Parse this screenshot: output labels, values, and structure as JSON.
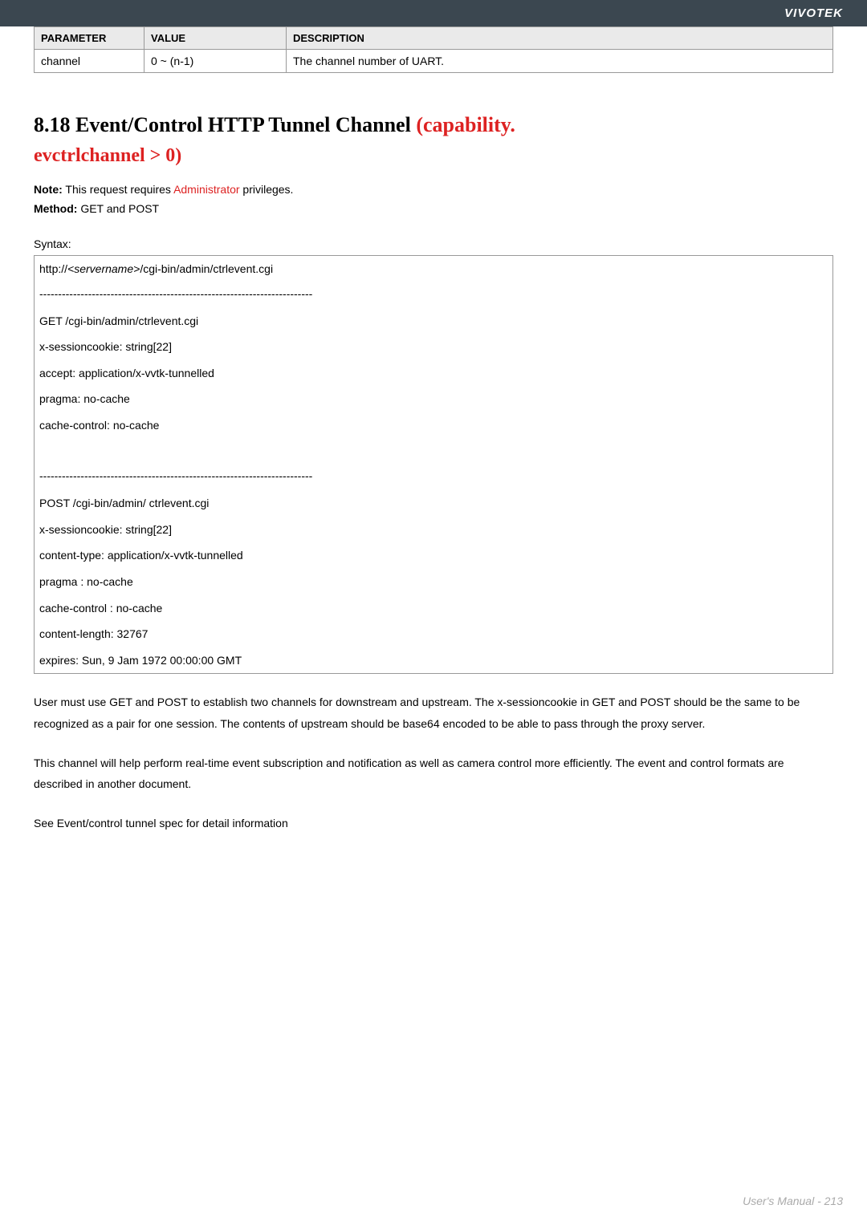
{
  "header": {
    "brand": "VIVOTEK"
  },
  "param_table": {
    "headers": [
      "PARAMETER",
      "VALUE",
      "DESCRIPTION"
    ],
    "rows": [
      {
        "parameter": "channel",
        "value": "0 ~ (n-1)",
        "description": "The channel number of UART."
      }
    ]
  },
  "section": {
    "number": "8.18",
    "title_black": "Event/Control HTTP Tunnel Channel",
    "title_red_line1": "(capability.",
    "title_red_line2": "evctrlchannel > 0)"
  },
  "notes": {
    "note_label": "Note:",
    "note_before": "This request requires",
    "note_admin": "Administrator",
    "note_after": "privileges.",
    "method_label": "Method:",
    "method_value": "GET and POST"
  },
  "syntax_label": "Syntax:",
  "block": {
    "url_prefix": "http://",
    "url_servername": "<servername>",
    "url_suffix": "/cgi-bin/admin/ctrlevent.cgi",
    "sep": "-------------------------------------------------------------------------",
    "get_lines": [
      "GET /cgi-bin/admin/ctrlevent.cgi",
      "x-sessioncookie: string[22]",
      "accept: application/x-vvtk-tunnelled",
      "pragma: no-cache",
      "cache-control: no-cache"
    ],
    "post_lines": [
      "POST /cgi-bin/admin/ ctrlevent.cgi",
      "x-sessioncookie: string[22]",
      "content-type: application/x-vvtk-tunnelled",
      "pragma : no-cache",
      "cache-control : no-cache",
      "content-length: 32767",
      "expires: Sun, 9 Jam 1972 00:00:00 GMT"
    ]
  },
  "body": {
    "p1": "User must use GET and POST to establish two channels for downstream and upstream. The x-sessioncookie in GET and POST should be the same to be recognized as a pair for one session. The contents of upstream should be base64 encoded to be able to pass through the proxy server.",
    "p2": "This channel will help perform real-time event subscription and notification as well as camera control more efficiently. The event and control formats are described in another document.",
    "p3": "See Event/control tunnel spec for detail information"
  },
  "footer": {
    "text": "User's Manual - 213"
  }
}
